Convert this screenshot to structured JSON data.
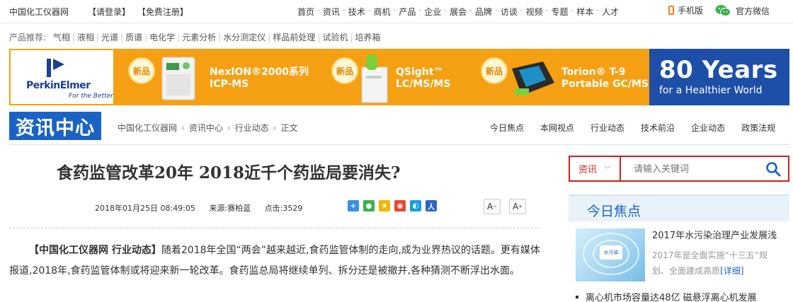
{
  "topbar": {
    "site_name": "中国化工仪器网",
    "login": "【请登录】",
    "register": "【免费注册】",
    "nav": [
      "首页",
      "资讯",
      "技术",
      "商机",
      "产品",
      "企业",
      "展会",
      "品牌",
      "访谈",
      "视频",
      "专题",
      "样本",
      "人才"
    ],
    "mobile": "手机版",
    "wechat": "官方微信"
  },
  "recommend": {
    "label": "产品推荐:",
    "items": [
      "气相",
      "液相",
      "光谱",
      "质谱",
      "电化学",
      "元素分析",
      "水分测定仪",
      "样品前处理",
      "试验机",
      "培养箱"
    ]
  },
  "banner": {
    "brand": "PerkinElmer",
    "brand_tag": "For the Better",
    "new_badge": "新品",
    "products": [
      {
        "line1": "NexION®2000系列",
        "line2": "ICP-MS"
      },
      {
        "line1": "QSight™",
        "line2": "LC/MS/MS"
      },
      {
        "line1": "Torion® T-9",
        "line2": "Portable GC/MS"
      }
    ],
    "years_big": "80 Years",
    "years_small": "for a Healthier World",
    "colors": {
      "orange": "#f5a013",
      "blue": "#1d4fa8"
    }
  },
  "section": {
    "logo": "资讯中心",
    "breadcrumb": [
      "中国化工仪器网",
      "资讯中心",
      "行业动态",
      "正文"
    ],
    "subnav": [
      "今日焦点",
      "本网视点",
      "行业动态",
      "技术前沿",
      "企业动态",
      "政策法规"
    ]
  },
  "article": {
    "title": "食药监管改革20年  2018近千个药监局要消失?",
    "date": "2018年01月25日 08:49:05",
    "source": "来源:赛柏蓝",
    "clicks": "点击:3529",
    "font_smaller": "A",
    "font_larger": "A",
    "lead_bold": "【中国化工仪器网 行业动态】",
    "lead_text": "随着2018年全国“两会”越来越近,食药监管体制的走向,成为业界热议的话题。更有媒体报道,2018年,食药监管体制或将迎来新一轮改革。食药监总局将继续单列、拆分还是被撤并,各种猜测不断浮出水面。"
  },
  "sidebar": {
    "search_category": "资讯",
    "search_placeholder": "请输入关键词",
    "focus_title": "今日焦点",
    "thumb_label": "水污染",
    "top_item": {
      "title": "2017年水污染治理产业发展浅",
      "desc": "2017年是全面实施“十三五”规划、全面建成高质",
      "more": "[详细]"
    },
    "next_item": "离心机市场容量达48亿 磁悬浮离心机发展"
  }
}
